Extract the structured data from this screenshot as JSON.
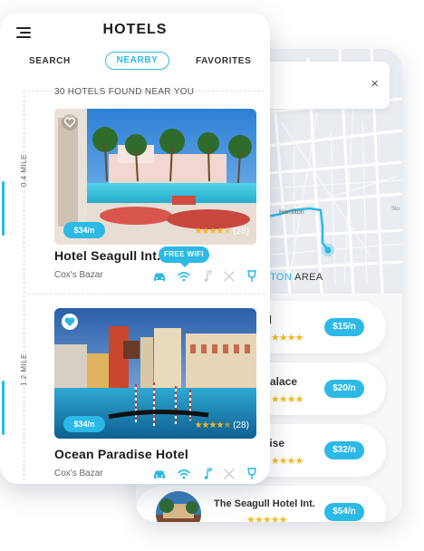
{
  "header": {
    "title": "HOTELS"
  },
  "tabs": {
    "search": "SEARCH",
    "nearby": "NEARBY",
    "favorites": "FAVORITES",
    "active": "NEARBY"
  },
  "found_text": "30 HOTELS FOUND NEAR YOU",
  "distances": {
    "first": "0.4 MILE",
    "second": "1.2 MILE"
  },
  "hotels": [
    {
      "name": "Hotel Seagull Int.",
      "location": "Cox's Bazar",
      "price": "$34/n",
      "stars": "★★★★",
      "partial_star": "★",
      "reviews": "(28)",
      "favorite": false,
      "tooltip": "FREE WIFI"
    },
    {
      "name": "Ocean Paradise Hotel",
      "location": "Cox's Bazar",
      "price": "$34/n",
      "stars": "★★★★",
      "partial_star": "★",
      "reviews": "(28)",
      "favorite": true
    }
  ],
  "amenity_icons": [
    "car-icon",
    "wifi-icon",
    "music-icon",
    "restaurant-icon",
    "bar-icon"
  ],
  "map": {
    "close_glyph": "×",
    "street_label": "Hamilton",
    "area_accent": "TON",
    "area_rest": " AREA"
  },
  "map_list": [
    {
      "name": "el",
      "price": "$15/n"
    },
    {
      "name": "Palace",
      "price": "$20/n"
    },
    {
      "name": "dise",
      "price": "$32/n"
    },
    {
      "name": "The Seagull Hotel Int.",
      "price": "$54/n"
    }
  ],
  "colors": {
    "accent": "#2cb9e6",
    "star": "#f5b920",
    "text": "#1b1b1b"
  }
}
